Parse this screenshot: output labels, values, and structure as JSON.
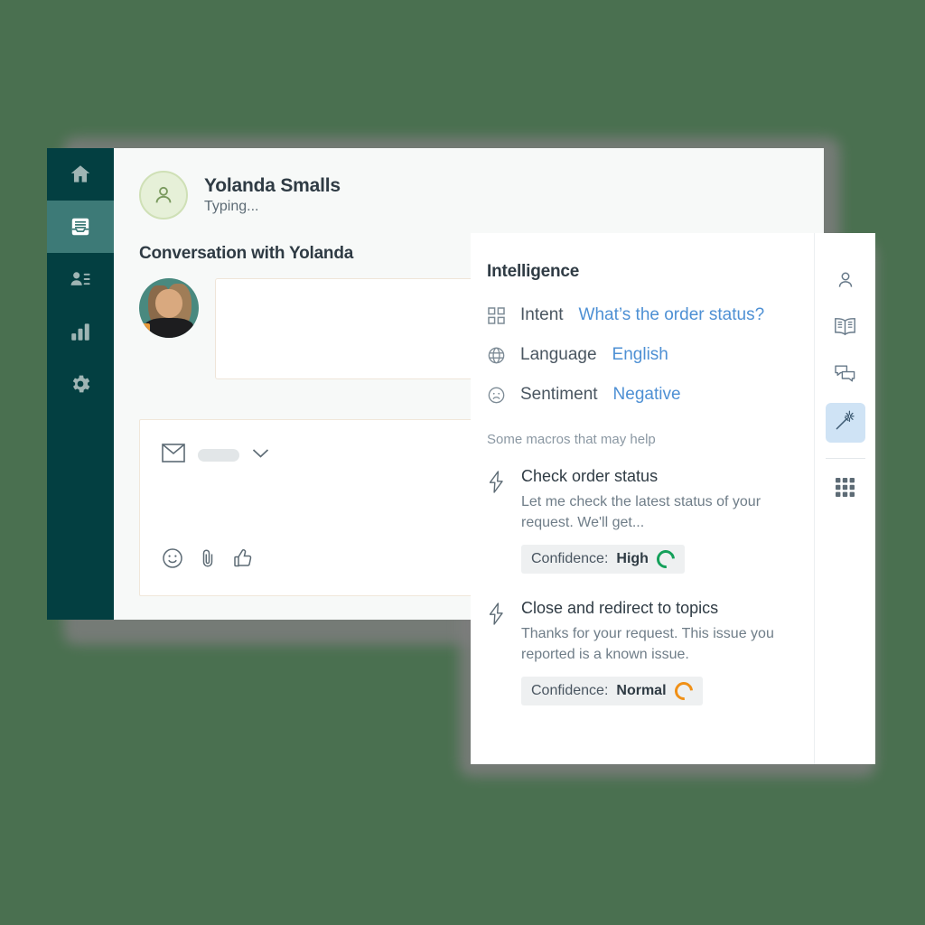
{
  "theme": {
    "page_background": "#4a7050",
    "sidebar_background": "#033f41",
    "sidebar_active": "#3d7a77",
    "accent_link": "#4e90d4",
    "rail_active": "#cfe3f5",
    "confidence_high": "#14a05a",
    "confidence_normal": "#f09017"
  },
  "sidebar": {
    "items": [
      {
        "icon": "home-icon",
        "label": "Home",
        "active": false
      },
      {
        "icon": "inbox-icon",
        "label": "Inbox",
        "active": true
      },
      {
        "icon": "contacts-icon",
        "label": "Contacts",
        "active": false
      },
      {
        "icon": "reports-icon",
        "label": "Reports",
        "active": false
      },
      {
        "icon": "settings-icon",
        "label": "Settings",
        "active": false
      }
    ]
  },
  "conversation": {
    "contact_name": "Yolanda Smalls",
    "contact_status": "Typing...",
    "title": "Conversation with Yolanda"
  },
  "tab_bar": {
    "add_label": "+"
  },
  "composer": {
    "channel_icon": "envelope-icon",
    "dropdown_icon": "chevron-down-icon",
    "actions": [
      "emoji-icon",
      "attachment-icon",
      "thumbs-up-icon"
    ]
  },
  "intelligence": {
    "title": "Intelligence",
    "rows": [
      {
        "icon": "grid-small-icon",
        "label": "Intent",
        "value": "What’s the order status?"
      },
      {
        "icon": "globe-icon",
        "label": "Language",
        "value": "English"
      },
      {
        "icon": "sentiment-icon",
        "label": "Sentiment",
        "value": "Negative"
      }
    ],
    "macros_heading": "Some macros that may help",
    "macros": [
      {
        "icon": "bolt-icon",
        "title": "Check order status",
        "description": "Let me check the latest status of your request. We'll get...",
        "confidence_label": "Confidence:",
        "confidence_value": "High",
        "confidence_color": "#14a05a"
      },
      {
        "icon": "bolt-icon",
        "title": "Close and redirect to topics",
        "description": "Thanks for your request. This issue you reported is a known issue.",
        "confidence_label": "Confidence:",
        "confidence_value": "Normal",
        "confidence_color": "#f09017"
      }
    ],
    "rail": [
      {
        "icon": "person-icon",
        "label": "Customer",
        "active": false
      },
      {
        "icon": "knowledge-icon",
        "label": "Knowledge",
        "active": false
      },
      {
        "icon": "chat-icon",
        "label": "Conversations",
        "active": false
      },
      {
        "icon": "magic-wand-icon",
        "label": "Intelligence",
        "active": true
      },
      {
        "icon": "apps-grid-icon",
        "label": "Apps",
        "active": false
      }
    ]
  }
}
